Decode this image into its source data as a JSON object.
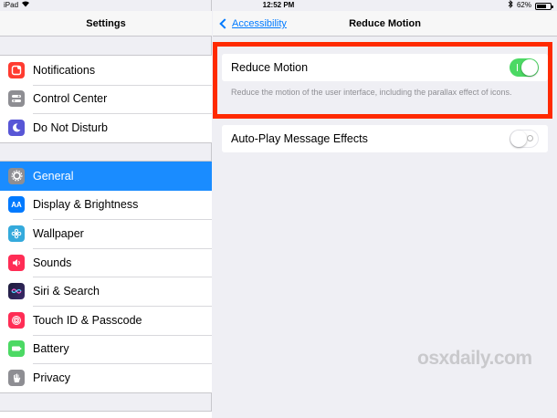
{
  "status_bar": {
    "carrier": "iPad",
    "wifi_icon": "wifi-icon",
    "time": "12:52 PM",
    "battery_percent": "62%",
    "battery_level": 0.62
  },
  "left_nav": {
    "title": "Settings"
  },
  "right_nav": {
    "back_label": "Accessibility",
    "title": "Reduce Motion"
  },
  "settings_groups": [
    {
      "items": [
        {
          "label": "Notifications",
          "icon": "notifications-icon",
          "color": "#ff3b30"
        },
        {
          "label": "Control Center",
          "icon": "control-center-icon",
          "color": "#8e8e93"
        },
        {
          "label": "Do Not Disturb",
          "icon": "moon-icon",
          "color": "#5856d6"
        }
      ]
    },
    {
      "items": [
        {
          "label": "General",
          "icon": "gear-icon",
          "color": "#8e8e93",
          "selected": true
        },
        {
          "label": "Display & Brightness",
          "icon": "display-icon",
          "color": "#007aff"
        },
        {
          "label": "Wallpaper",
          "icon": "wallpaper-icon",
          "color": "#34aadc"
        },
        {
          "label": "Sounds",
          "icon": "speaker-icon",
          "color": "#ff2d55"
        },
        {
          "label": "Siri & Search",
          "icon": "siri-icon",
          "color": "#2c2c54"
        },
        {
          "label": "Touch ID & Passcode",
          "icon": "fingerprint-icon",
          "color": "#ff2d55"
        },
        {
          "label": "Battery",
          "icon": "battery-icon",
          "color": "#4cd964"
        },
        {
          "label": "Privacy",
          "icon": "hand-icon",
          "color": "#8e8e93"
        }
      ]
    }
  ],
  "reduce_motion": {
    "label": "Reduce Motion",
    "enabled": true,
    "description": "Reduce the motion of the user interface, including the parallax effect of icons."
  },
  "autoplay_effects": {
    "label": "Auto-Play Message Effects",
    "enabled": false
  },
  "colors": {
    "accent": "#007aff",
    "selected_row": "#1a8cff",
    "toggle_on": "#4cd964",
    "highlight_box": "#ff2a00"
  },
  "watermark": "osxdaily.com"
}
